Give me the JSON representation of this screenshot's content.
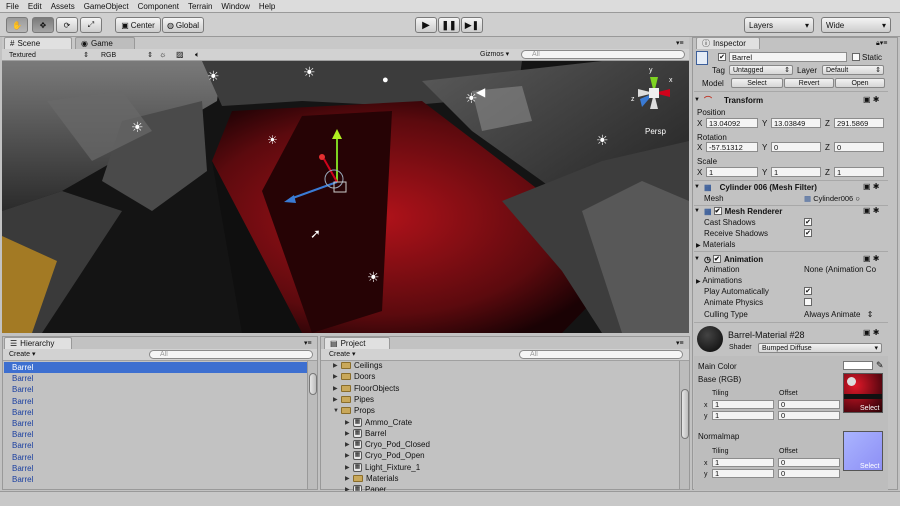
{
  "menu": [
    "File",
    "Edit",
    "Assets",
    "GameObject",
    "Component",
    "Terrain",
    "Window",
    "Help"
  ],
  "toolbar": {
    "center_label": "Center",
    "global_label": "Global",
    "layers_label": "Layers",
    "layout_label": "Wide"
  },
  "scene": {
    "tab_scene": "Scene",
    "tab_game": "Game",
    "render_mode": "Textured",
    "color_mode": "RGB",
    "gizmos_label": "Gizmos",
    "search_placeholder": "All",
    "persp_label": "Persp",
    "gizmo_axis_y": "y",
    "gizmo_axis_x": "x",
    "gizmo_axis_z": "z"
  },
  "hierarchy": {
    "tab": "Hierarchy",
    "create_label": "Create",
    "search_placeholder": "All",
    "items": [
      "Barrel",
      "Barrel",
      "Barrel",
      "Barrel",
      "Barrel",
      "Barrel",
      "Barrel",
      "Barrel",
      "Barrel",
      "Barrel",
      "Barrel"
    ]
  },
  "project": {
    "tab": "Project",
    "create_label": "Create",
    "search_placeholder": "All",
    "items": [
      {
        "label": "Ceilings",
        "kind": "folder",
        "depth": 0,
        "open": false
      },
      {
        "label": "Doors",
        "kind": "folder",
        "depth": 0,
        "open": false
      },
      {
        "label": "FloorObjects",
        "kind": "folder",
        "depth": 0,
        "open": false
      },
      {
        "label": "Pipes",
        "kind": "folder",
        "depth": 0,
        "open": false
      },
      {
        "label": "Props",
        "kind": "folder",
        "depth": 0,
        "open": true
      },
      {
        "label": "Ammo_Crate",
        "kind": "prefab",
        "depth": 1,
        "open": false
      },
      {
        "label": "Barrel",
        "kind": "prefab",
        "depth": 1,
        "open": false
      },
      {
        "label": "Cryo_Pod_Closed",
        "kind": "prefab",
        "depth": 1,
        "open": false
      },
      {
        "label": "Cryo_Pod_Open",
        "kind": "prefab",
        "depth": 1,
        "open": false
      },
      {
        "label": "Light_Fixture_1",
        "kind": "prefab",
        "depth": 1,
        "open": false
      },
      {
        "label": "Materials",
        "kind": "folder",
        "depth": 1,
        "open": false
      },
      {
        "label": "Paper",
        "kind": "prefab",
        "depth": 1,
        "open": false
      }
    ]
  },
  "inspector": {
    "tab": "Inspector",
    "object_name": "Barrel",
    "static_label": "Static",
    "tag_label": "Tag",
    "tag_value": "Untagged",
    "layer_label": "Layer",
    "layer_value": "Default",
    "model_label": "Model",
    "select_label": "Select",
    "revert_label": "Revert",
    "open_label": "Open",
    "transform": {
      "title": "Transform",
      "position_label": "Position",
      "rotation_label": "Rotation",
      "scale_label": "Scale",
      "x_label": "X",
      "y_label": "Y",
      "z_label": "Z",
      "position": [
        "13.04092",
        "13.03849",
        "291.5869"
      ],
      "rotation": [
        "-57.51312",
        "0",
        "0"
      ],
      "scale": [
        "1",
        "1",
        "1"
      ]
    },
    "mesh_filter": {
      "title": "Cylinder 006 (Mesh Filter)",
      "mesh_label": "Mesh",
      "mesh_value": "Cylinder006"
    },
    "mesh_renderer": {
      "title": "Mesh Renderer",
      "cast_shadows": "Cast Shadows",
      "receive_shadows": "Receive Shadows",
      "materials": "Materials"
    },
    "animation": {
      "title": "Animation",
      "animation_label": "Animation",
      "animation_value": "None (Animation Co",
      "animations_label": "Animations",
      "play_auto": "Play Automatically",
      "animate_physics": "Animate Physics",
      "culling_label": "Culling Type",
      "culling_value": "Always Animate"
    },
    "material": {
      "title": "Barrel-Material #28",
      "shader_label": "Shader",
      "shader_value": "Bumped Diffuse",
      "main_color": "Main Color",
      "base_label": "Base (RGB)",
      "tiling": "Tiling",
      "offset": "Offset",
      "x": "x",
      "y": "y",
      "tiling_x": "1",
      "tiling_y": "1",
      "offset_x": "0",
      "offset_y": "0",
      "select_label": "Select",
      "normalmap_label": "Normalmap",
      "n_tiling_x": "1",
      "n_tiling_y": "1",
      "n_offset_x": "0",
      "n_offset_y": "0",
      "n_select_label": "Select"
    }
  },
  "colors": {
    "selection": "#3d6fd0",
    "hierarchy_text": "#1a3fa0"
  },
  "icons": [
    "hand-tool-icon",
    "move-tool-icon",
    "rotate-tool-icon",
    "scale-tool-icon",
    "play-icon",
    "pause-icon",
    "step-icon",
    "light-icon",
    "camera-icon",
    "lock-icon"
  ]
}
